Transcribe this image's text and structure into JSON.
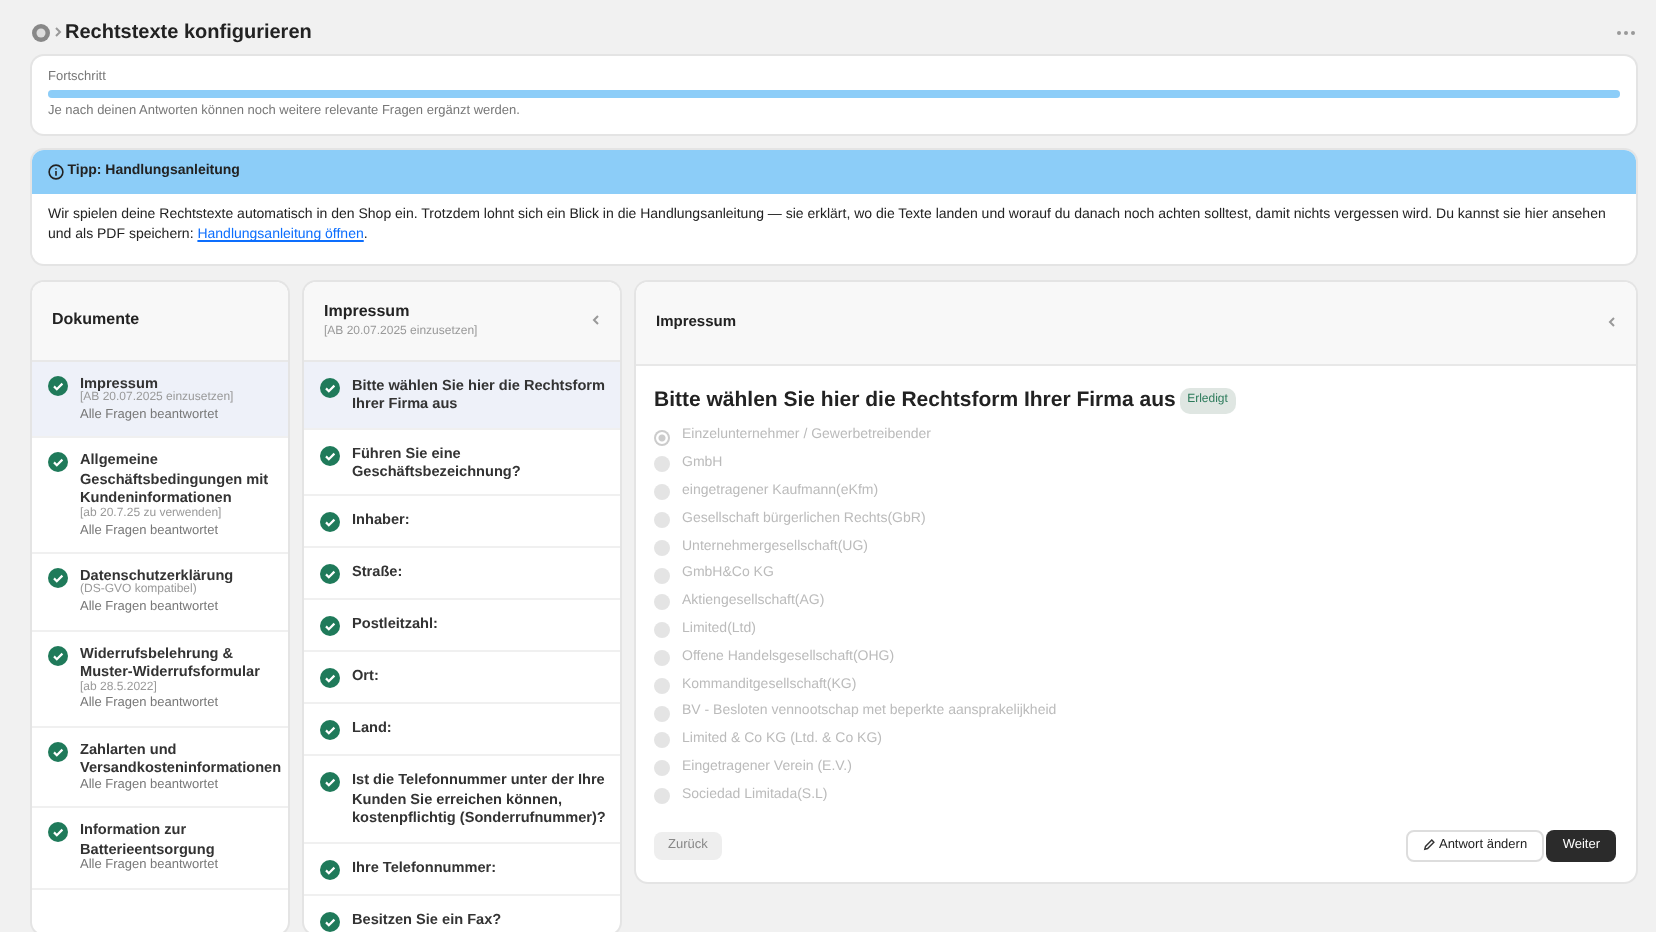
{
  "header": {
    "title": "Rechtstexte konfigurieren"
  },
  "progress": {
    "label": "Fortschritt",
    "level": 1,
    "hint": "Je nach deinen Antworten können noch weitere relevante Fragen ergänzt werden."
  },
  "tip": {
    "title": "Tipp: Handlungsanleitung",
    "text": "Wir spielen deine Rechtstexte automatisch in den Shop ein. Trotzdem lohnt sich ein Blick in die Handlungsanleitung — sie erklärt, wo die Texte landen und worauf du danach noch achten solltest, damit nichts vergessen wird. Du kannst sie hier ansehen und als PDF speichern:",
    "link": "Handlungsanleitung öffnen",
    "link_suffix": "."
  },
  "documents": {
    "title": "Dokumente",
    "items": [
      {
        "title": "Impressum",
        "note": "[AB 20.07.2025 einzusetzen]",
        "status": "Alle Fragen beantwortet",
        "done": true,
        "selected": true
      },
      {
        "title": "Allgemeine Geschäftsbedingungen mit Kundeninformationen",
        "note": "[ab 20.7.25 zu verwenden]",
        "status": "Alle Fragen beantwortet",
        "done": true,
        "selected": false
      },
      {
        "title": "Datenschutzerklärung",
        "note": "(DS-GVO kompatibel)",
        "status": "Alle Fragen beantwortet",
        "done": true,
        "selected": false
      },
      {
        "title": "Widerrufsbelehrung & Muster-Widerrufsformular",
        "note": "[ab 28.5.2022]",
        "status": "Alle Fragen beantwortet",
        "done": true,
        "selected": false
      },
      {
        "title": "Zahlarten und Versandkosteninformationen",
        "status": "Alle Fragen beantwortet",
        "done": true,
        "selected": false
      },
      {
        "title": "Information zur Batterieentsorgung",
        "status": "Alle Fragen beantwortet",
        "done": true,
        "selected": false
      }
    ]
  },
  "questions": {
    "title": "Impressum",
    "subtitle": "[AB 20.07.2025 einzusetzen]",
    "items": [
      {
        "text": "Bitte wählen Sie hier die Rechtsform Ihrer Firma aus",
        "done": true,
        "selected": true
      },
      {
        "text": "Führen Sie eine Geschäftsbezeichnung?",
        "done": true,
        "selected": false
      },
      {
        "text": "Inhaber:",
        "done": true,
        "selected": false
      },
      {
        "text": "Straße:",
        "done": true,
        "selected": false
      },
      {
        "text": "Postleitzahl:",
        "done": true,
        "selected": false
      },
      {
        "text": "Ort:",
        "done": true,
        "selected": false
      },
      {
        "text": "Land:",
        "done": true,
        "selected": false
      },
      {
        "text": "Ist die Telefonnummer unter der Ihre Kunden Sie erreichen können, kostenpflichtig (Sonderrufnummer)?",
        "done": true,
        "selected": false
      },
      {
        "text": "Ihre Telefonnummer:",
        "done": true,
        "selected": false
      },
      {
        "text": "Besitzen Sie ein Fax?",
        "done": true,
        "selected": false
      }
    ]
  },
  "detail": {
    "title": "Impressum",
    "question": "Bitte wählen Sie hier die Rechtsform Ihrer Firma aus",
    "badge": "Erledigt",
    "disabled": true,
    "options": [
      {
        "label": "Einzelunternehmer / Gewerbetreibender",
        "selected": true
      },
      {
        "label": "GmbH",
        "selected": false
      },
      {
        "label": "eingetragener Kaufmann(eKfm)",
        "selected": false
      },
      {
        "label": "Gesellschaft bürgerlichen Rechts(GbR)",
        "selected": false
      },
      {
        "label": "Unternehmergesellschaft(UG)",
        "selected": false
      },
      {
        "label": "GmbH&Co KG",
        "selected": false
      },
      {
        "label": "Aktiengesellschaft(AG)",
        "selected": false
      },
      {
        "label": "Limited(Ltd)",
        "selected": false
      },
      {
        "label": "Offene Handelsgesellschaft(OHG)",
        "selected": false
      },
      {
        "label": "Kommanditgesellschaft(KG)",
        "selected": false
      },
      {
        "label": "BV - Besloten vennootschap met beperkte aansprakelijkheid",
        "selected": false
      },
      {
        "label": "Limited & Co KG (Ltd. & Co KG)",
        "selected": false
      },
      {
        "label": "Eingetragener Verein (E.V.)",
        "selected": false
      },
      {
        "label": "Sociedad Limitada(S.L)",
        "selected": false
      }
    ],
    "back": {
      "label": "Zurück",
      "disabled": true
    },
    "edit": "Antwort ändern",
    "next": "Weiter"
  }
}
